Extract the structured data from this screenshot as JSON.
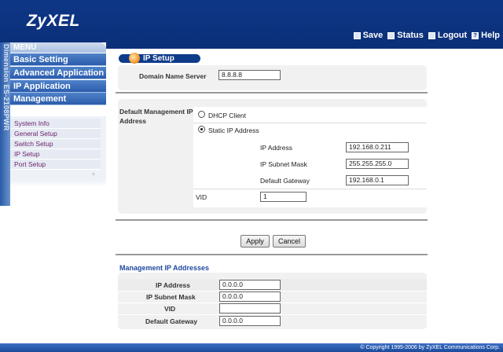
{
  "header": {
    "brand": "ZyXEL",
    "toolbar": {
      "save": "Save",
      "status": "Status",
      "logout": "Logout",
      "help": "Help"
    }
  },
  "sidebar": {
    "vertical_label": "Dimension  ES-2108PWR",
    "menu_label": "MENU",
    "categories": [
      "Basic Setting",
      "Advanced Application",
      "IP Application",
      "Management"
    ],
    "items": [
      "System Info",
      "General Setup",
      "Switch Setup",
      "IP Setup",
      "Port Setup"
    ]
  },
  "page": {
    "title": "IP Setup",
    "dns": {
      "label": "Domain Name Server",
      "value": "8.8.8.8"
    },
    "default_mgmt": {
      "label_line1": "Default Management IP",
      "label_line2": "Address",
      "dhcp_label": "DHCP Client",
      "static_label": "Static IP Address",
      "selected": "static",
      "ip_label": "IP Address",
      "ip_value": "192.168.0.211",
      "mask_label": "IP Subnet Mask",
      "mask_value": "255.255.255.0",
      "gateway_label": "Default Gateway",
      "gateway_value": "192.168.0.1",
      "vid_label": "VID",
      "vid_value": "1"
    },
    "buttons": {
      "apply": "Apply",
      "cancel": "Cancel"
    },
    "mgmt_addresses": {
      "title": "Management IP Addresses",
      "ip_label": "IP Address",
      "ip_value": "0.0.0.0",
      "mask_label": "IP Subnet Mask",
      "mask_value": "0.0.0.0",
      "vid_label": "VID",
      "vid_value": "",
      "gateway_label": "Default Gateway",
      "gateway_value": "0.0.0.0"
    }
  },
  "footer": {
    "copyright": "© Copyright 1995-2006 by ZyXEL Communications Corp."
  },
  "colors": {
    "header_bg": "#0e3787",
    "nav_blue": "#2b5cac",
    "link_purple": "#6b1f6b",
    "section_title": "#1f4aa0"
  }
}
